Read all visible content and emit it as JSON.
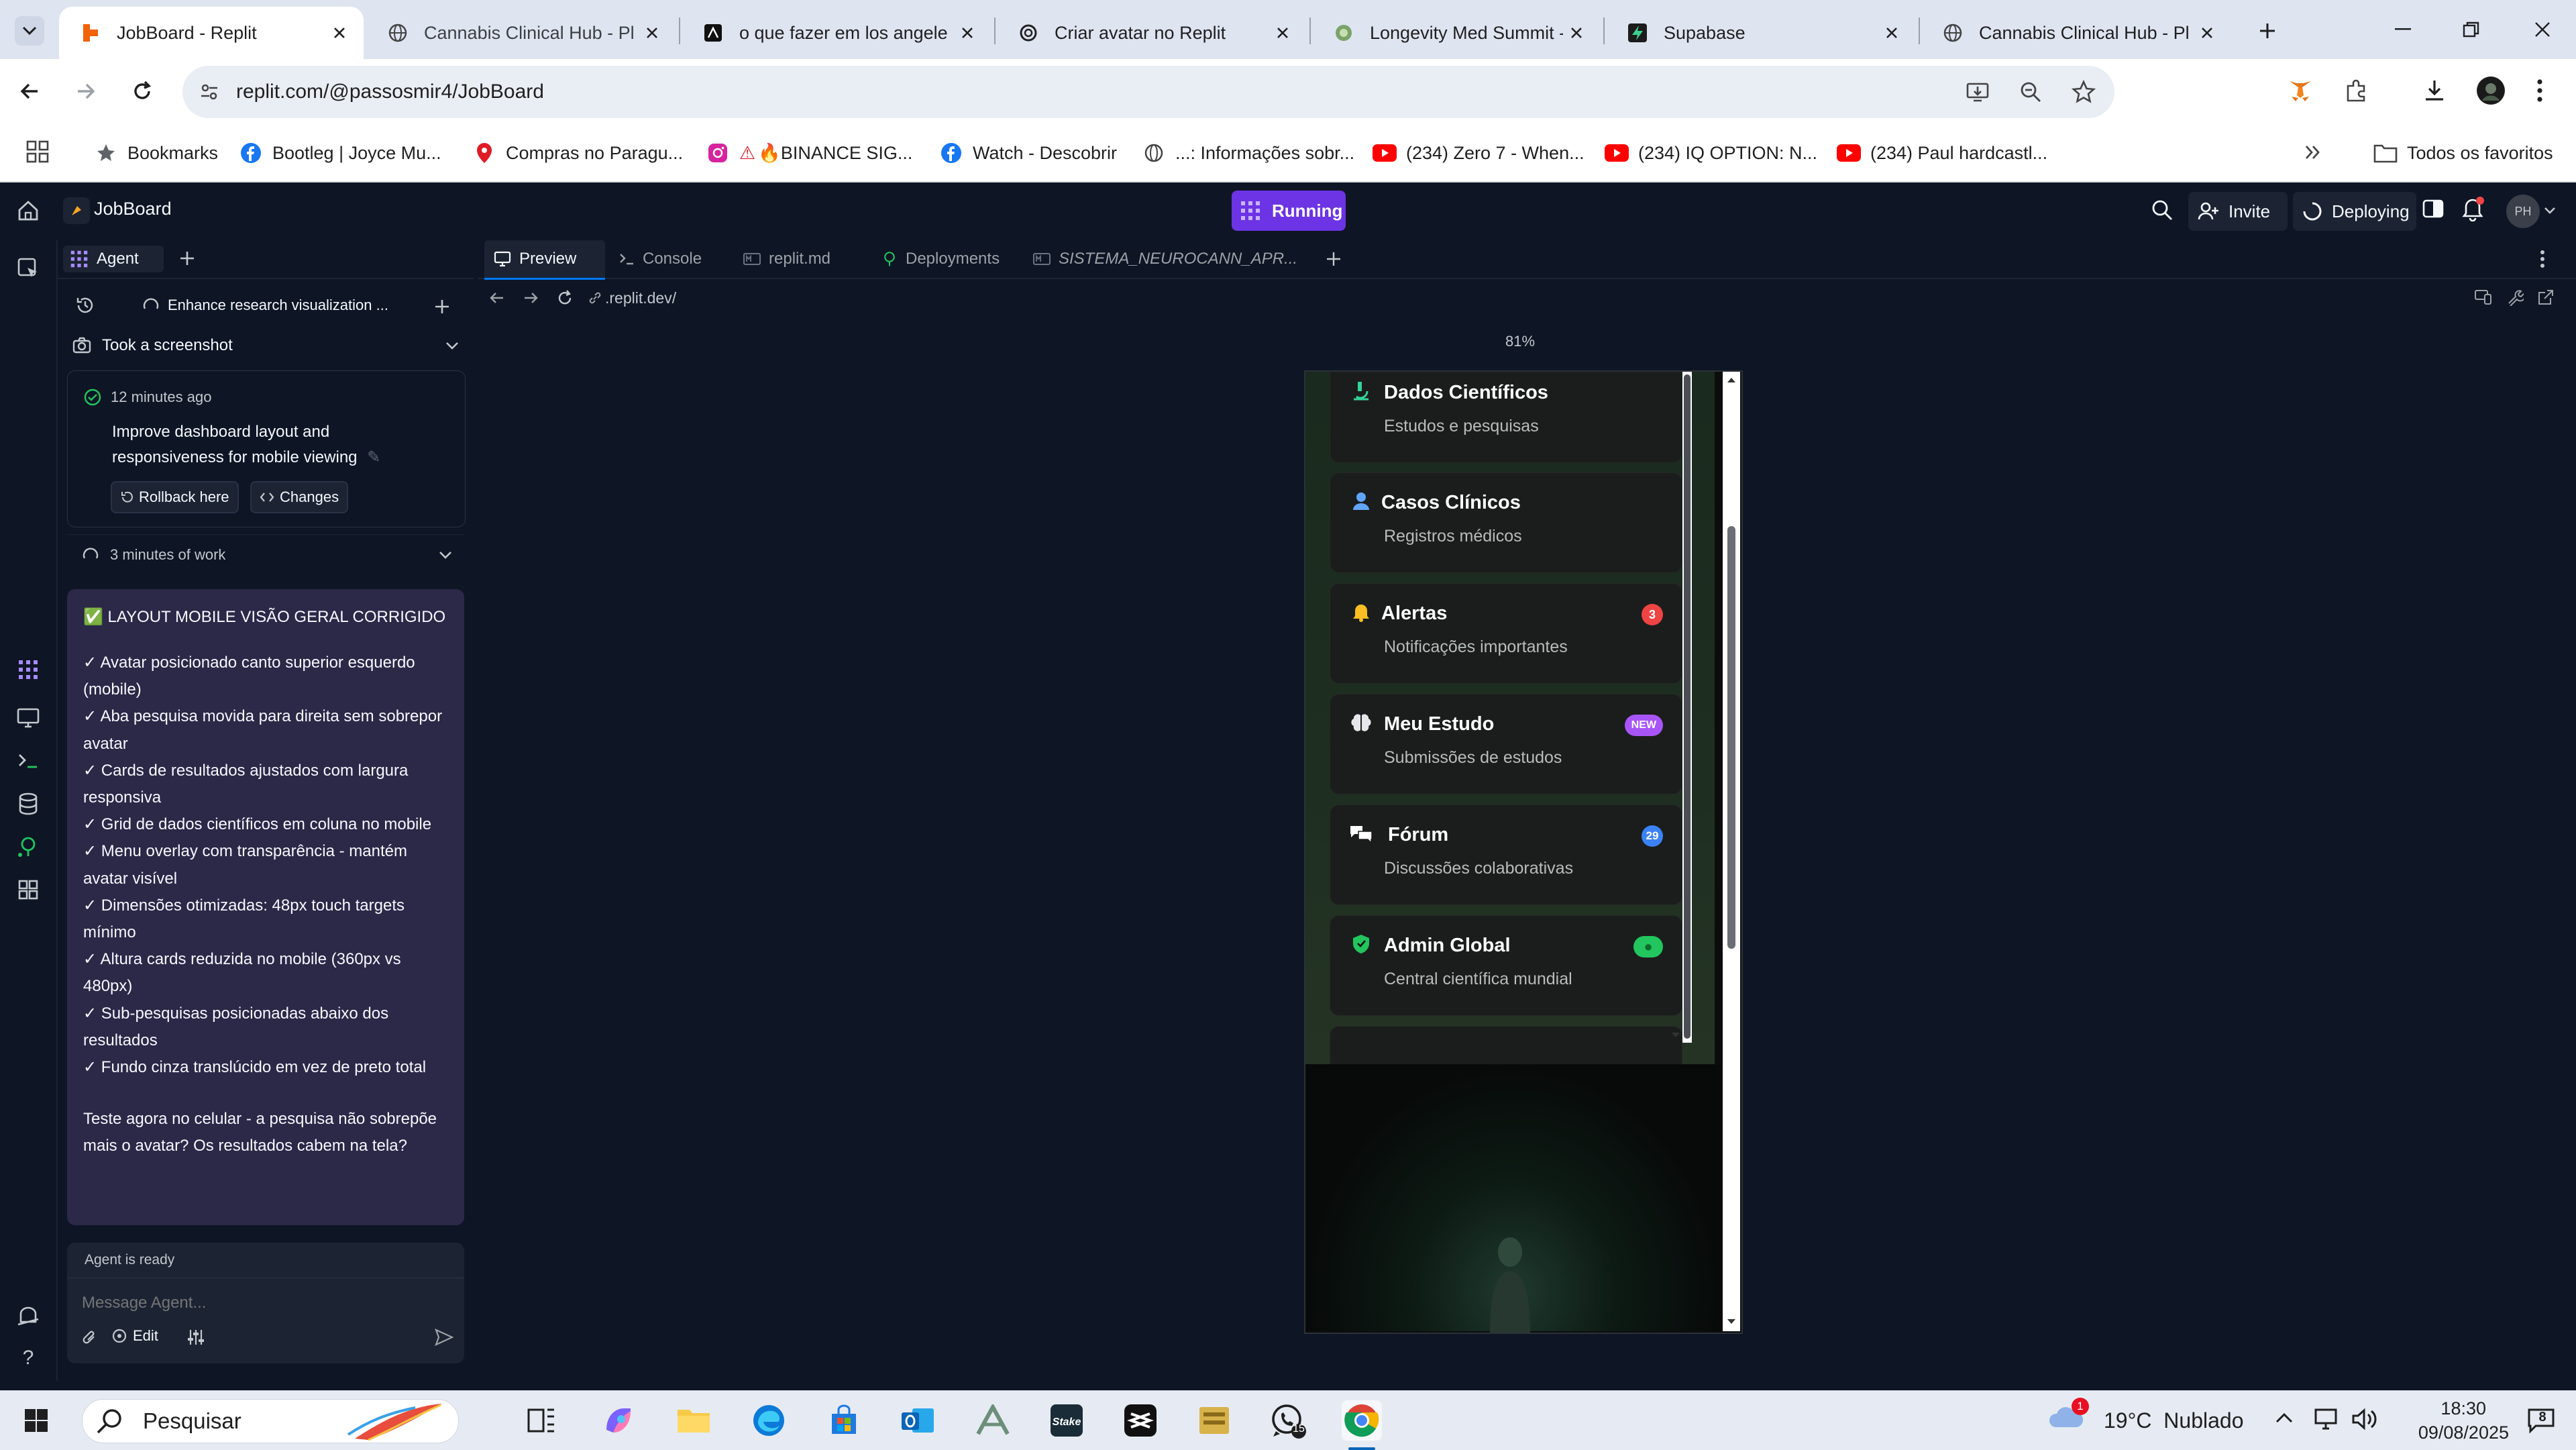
{
  "browser": {
    "tabs": [
      {
        "title": "JobBoard - Replit",
        "active": true
      },
      {
        "title": "Cannabis Clinical Hub - Pl",
        "active": false
      },
      {
        "title": "o que fazer em los angele",
        "active": false
      },
      {
        "title": "Criar avatar no Replit",
        "active": false
      },
      {
        "title": "Longevity Med Summit -",
        "active": false
      },
      {
        "title": "Supabase",
        "active": false
      },
      {
        "title": "Cannabis Clinical Hub - Pl",
        "active": false
      }
    ],
    "url": "replit.com/@passosmir4/JobBoard",
    "bookmarks": [
      "Bookmarks",
      "Bootleg | Joyce Mu...",
      "Compras no Paragu...",
      "🔥BINANCE SIG...",
      "Watch - Descobrir",
      "...: Informações sobr...",
      "(234) Zero 7 - When...",
      "(234) IQ OPTION: N...",
      "(234) Paul hardcastl..."
    ],
    "all_bookmarks": "Todos os favoritos"
  },
  "replit": {
    "repl_name": "JobBoard",
    "run_status": "Running",
    "invite_label": "Invite",
    "deploy_label": "Deploying",
    "avatar_initials": "PH"
  },
  "agent": {
    "tab_label": "Agent",
    "thread_title": "Enhance research visualization ...",
    "screenshot_label": "Took a screenshot",
    "checkpoint_time": "12 minutes ago",
    "checkpoint_text": "Improve dashboard layout and responsiveness for mobile viewing",
    "rollback_label": "Rollback here",
    "changes_label": "Changes",
    "work_label": "3 minutes of work",
    "message_title": "✅ LAYOUT MOBILE VISÃO GERAL CORRIGIDO",
    "message_items": [
      "✓ Avatar posicionado canto superior esquerdo (mobile)",
      "✓ Aba pesquisa movida para direita sem sobrepor avatar",
      "✓ Cards de resultados ajustados com largura responsiva",
      "✓ Grid de dados científicos em coluna no mobile",
      "✓ Menu overlay com transparência - mantém avatar visível",
      "✓ Dimensões otimizadas: 48px touch targets mínimo",
      "✓ Altura cards reduzida no mobile (360px vs 480px)",
      "✓ Sub-pesquisas posicionadas abaixo dos resultados",
      "✓ Fundo cinza translúcido em vez de preto total"
    ],
    "message_footer": "Teste agora no celular - a pesquisa não sobrepõe mais o avatar? Os resultados cabem na tela?",
    "status": "Agent is ready",
    "input_placeholder": "Message Agent...",
    "edit_label": "Edit"
  },
  "workspace": {
    "tabs": [
      "Preview",
      "Console",
      "replit.md",
      "Deployments",
      "SISTEMA_NEUROCANN_APR..."
    ],
    "preview_url": ".replit.dev/",
    "zoom": "81%"
  },
  "app_menu": [
    {
      "title": "Dados Científicos",
      "subtitle": "Estudos e pesquisas",
      "icon": "microscope-icon",
      "icon_color": "#34d399",
      "badge": ""
    },
    {
      "title": "Casos Clínicos",
      "subtitle": "Registros médicos",
      "icon": "user-icon",
      "icon_color": "#60a5fa",
      "badge": ""
    },
    {
      "title": "Alertas",
      "subtitle": "Notificações importantes",
      "icon": "bell-icon",
      "icon_color": "#fbbf24",
      "badge": "3",
      "badge_color": "#ef4444"
    },
    {
      "title": "Meu Estudo",
      "subtitle": "Submissões de estudos",
      "icon": "brain-icon",
      "icon_color": "#e5e7eb",
      "badge": "NEW",
      "badge_color": "#a855f7"
    },
    {
      "title": "Fórum",
      "subtitle": "Discussões colaborativas",
      "icon": "chat-icon",
      "icon_color": "#ffffff",
      "badge": "29",
      "badge_color": "#3b82f6"
    },
    {
      "title": "Admin Global",
      "subtitle": "Central científica mundial",
      "icon": "shield-icon",
      "icon_color": "#22c55e",
      "badge": "●",
      "badge_color": "#22c55e"
    }
  ],
  "taskbar": {
    "search_placeholder": "Pesquisar",
    "weather": "19°C  Nublado",
    "weather_alert": "1",
    "whatsapp_count": "15",
    "time": "18:30",
    "date": "09/08/2025",
    "notification_count": "8"
  }
}
